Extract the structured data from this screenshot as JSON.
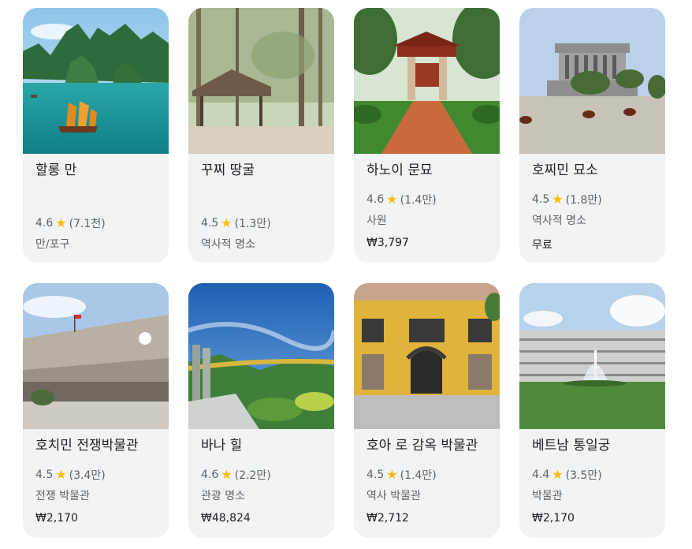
{
  "places": [
    {
      "name": "할롱 만",
      "rating": "4.6",
      "reviews": "(7.1천)",
      "category": "만/포구",
      "price": ""
    },
    {
      "name": "꾸찌 땅굴",
      "rating": "4.5",
      "reviews": "(1.3만)",
      "category": "역사적 명소",
      "price": ""
    },
    {
      "name": "하노이 문묘",
      "rating": "4.6",
      "reviews": "(1.4만)",
      "category": "사원",
      "price": "₩3,797"
    },
    {
      "name": "호찌민 묘소",
      "rating": "4.5",
      "reviews": "(1.8만)",
      "category": "역사적 명소",
      "price": "무료"
    },
    {
      "name": "호치민 전쟁박물관",
      "rating": "4.5",
      "reviews": "(3.4만)",
      "category": "전쟁 박물관",
      "price": "₩2,170"
    },
    {
      "name": "바나 힐",
      "rating": "4.6",
      "reviews": "(2.2만)",
      "category": "관광 명소",
      "price": "₩48,824"
    },
    {
      "name": "호아 로 감옥 박물관",
      "rating": "4.5",
      "reviews": "(1.4만)",
      "category": "역사 박물관",
      "price": "₩2,712"
    },
    {
      "name": "베트남 통일궁",
      "rating": "4.4",
      "reviews": "(3.5만)",
      "category": "박물관",
      "price": "₩2,170"
    }
  ],
  "star_icon": "star-icon",
  "colors": {
    "card_bg": "#f1f3f4",
    "star": "#fbbc04",
    "muted_text": "#5f6368"
  }
}
